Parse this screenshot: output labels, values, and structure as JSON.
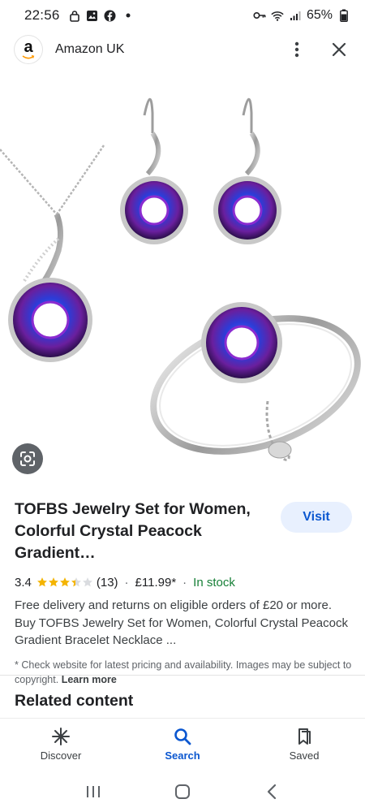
{
  "status_bar": {
    "time": "22:56",
    "battery": "65%",
    "left_icons": [
      "lock-icon",
      "image-icon",
      "facebook-icon",
      "dot-icon"
    ],
    "right_icons": [
      "key-icon",
      "wifi-icon",
      "signal-icon",
      "battery-icon"
    ]
  },
  "header": {
    "logo_letter": "a",
    "site_name": "Amazon UK",
    "more_icon": "more-vert-icon",
    "close_icon": "close-icon"
  },
  "product": {
    "title": "TOFBS Jewelry Set for Women, Colorful Crystal Peacock Gradient…",
    "visit_label": "Visit",
    "rating": "3.4",
    "rating_value": 3.4,
    "rating_max": 5,
    "reviews": "(13)",
    "price": "£11.99*",
    "stock": "In stock",
    "description": "Free delivery and returns on eligible orders of £20 or more. Buy TOFBS Jewelry Set for Women, Colorful Crystal Peacock Gradient Bracelet Necklace ...",
    "note": "* Check website for latest pricing and availability. Images may be subject to copyright.",
    "learn_more": "Learn more"
  },
  "related": {
    "title": "Related content"
  },
  "bottom_nav": {
    "items": [
      {
        "label": "Discover",
        "icon": "asterisk-icon"
      },
      {
        "label": "Search",
        "icon": "search-icon",
        "active": true
      },
      {
        "label": "Saved",
        "icon": "bookmark-icon"
      }
    ]
  },
  "colors": {
    "accent": "#0b57d0",
    "visit_bg": "#e8f0fe",
    "stock_green": "#188038",
    "star": "#f4b400"
  }
}
